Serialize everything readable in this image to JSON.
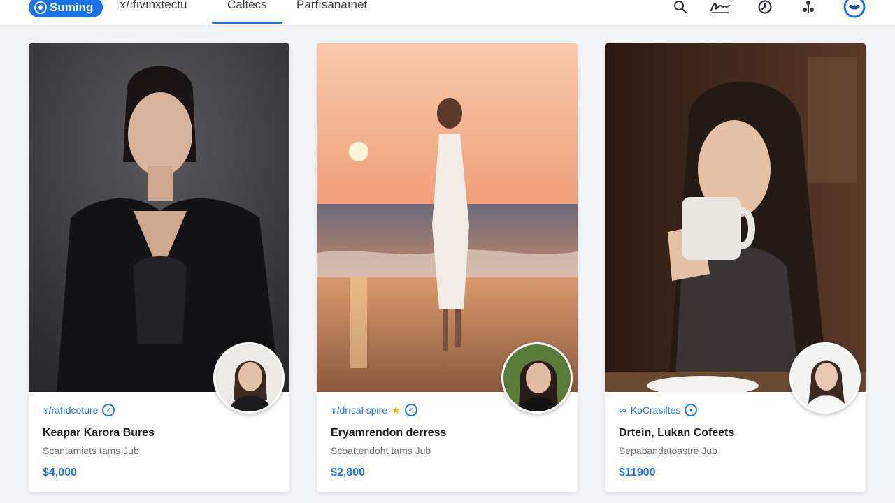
{
  "header": {
    "brand_label": "Suming",
    "nav": [
      {
        "label": "ɤ/ıfıvınxtectu"
      },
      {
        "label": "Caltecs"
      },
      {
        "label": "Parfısanaınet"
      }
    ]
  },
  "icons": {
    "search": "search-icon",
    "signature": "signature-icon",
    "history": "history-icon",
    "share": "share-icon",
    "profile": "profile-badge-icon"
  },
  "cards": [
    {
      "category": "ɤ/rafıdcoture",
      "title": "Keapar Karora Bures",
      "subtitle": "Scantamiets tams Jub",
      "price": "$4,000"
    },
    {
      "category": "ɤ/drıcal spire",
      "title": "Eryamrendon derress",
      "subtitle": "Scoattendoht tams Jub",
      "price": "$2,800"
    },
    {
      "category": "KoCrasiltes",
      "title": "Drtein, Lukan Cofeets",
      "subtitle": "Sepabandatoastre Jub",
      "price": "$11900"
    }
  ],
  "colors": {
    "accent": "#1a73e8",
    "card_bg": "#ffffff",
    "page_bg": "#f4f5f7"
  }
}
